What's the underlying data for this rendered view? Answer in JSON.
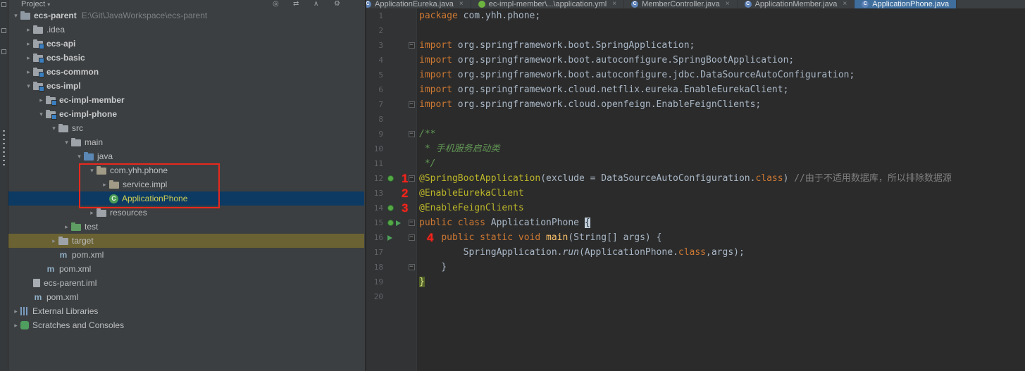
{
  "project_panel": {
    "header": {
      "title": "Project",
      "icons": [
        {
          "name": "locate-file-icon",
          "glyph": "◎"
        },
        {
          "name": "scroll-sync-icon",
          "glyph": "⇄"
        },
        {
          "name": "collapse-all-icon",
          "glyph": "∧"
        },
        {
          "name": "settings-icon",
          "glyph": "⚙"
        }
      ]
    },
    "tree": {
      "rows": [
        {
          "d": 0,
          "c": "o",
          "i": "project",
          "l": "ecs-parent",
          "x": "E:\\Git\\JavaWorkspace\\ecs-parent",
          "b": true
        },
        {
          "d": 1,
          "c": "c",
          "i": "folder",
          "l": ".idea"
        },
        {
          "d": 1,
          "c": "c",
          "i": "module",
          "l": "ecs-api",
          "b": true
        },
        {
          "d": 1,
          "c": "c",
          "i": "module",
          "l": "ecs-basic",
          "b": true
        },
        {
          "d": 1,
          "c": "c",
          "i": "module",
          "l": "ecs-common",
          "b": true
        },
        {
          "d": 1,
          "c": "o",
          "i": "module",
          "l": "ecs-impl",
          "b": true
        },
        {
          "d": 2,
          "c": "c",
          "i": "module",
          "l": "ec-impl-member",
          "b": true
        },
        {
          "d": 2,
          "c": "o",
          "i": "module",
          "l": "ec-impl-phone",
          "b": true
        },
        {
          "d": 3,
          "c": "o",
          "i": "folder",
          "l": "src"
        },
        {
          "d": 4,
          "c": "o",
          "i": "folder",
          "l": "main"
        },
        {
          "d": 5,
          "c": "o",
          "i": "java",
          "l": "java"
        },
        {
          "d": 6,
          "c": "o",
          "i": "package",
          "l": "com.yhh.phone"
        },
        {
          "d": 7,
          "c": "c",
          "i": "package",
          "l": "service.impl"
        },
        {
          "d": 7,
          "c": null,
          "i": "class",
          "l": "ApplicationPhone",
          "sel": true
        },
        {
          "d": 6,
          "c": "c",
          "i": "folder",
          "l": "resources"
        },
        {
          "d": 4,
          "c": "c",
          "i": "test",
          "l": "test"
        },
        {
          "d": 3,
          "c": "c",
          "i": "folder",
          "l": "target",
          "row": "olive"
        },
        {
          "d": 3,
          "c": null,
          "i": "maven",
          "l": "pom.xml"
        },
        {
          "d": 2,
          "c": null,
          "i": "maven",
          "l": "pom.xml"
        },
        {
          "d": 1,
          "c": null,
          "i": "iml",
          "l": "ecs-parent.iml"
        },
        {
          "d": 1,
          "c": null,
          "i": "maven",
          "l": "pom.xml"
        },
        {
          "d": 0,
          "c": "c",
          "i": "lib",
          "l": "External Libraries"
        },
        {
          "d": 0,
          "c": "c",
          "i": "scratch",
          "l": "Scratches and Consoles"
        }
      ]
    },
    "colors": {
      "selection": "#0d3a63",
      "excluded_row": "#6b6233",
      "annotation_red": "#e8281e"
    }
  },
  "editor": {
    "tabs": [
      {
        "l": "ApplicationEureka.java",
        "i": "class",
        "close": true
      },
      {
        "l": "ec-impl-member\\...\\application.yml",
        "i": "spring",
        "close": true
      },
      {
        "l": "MemberController.java",
        "i": "class",
        "close": true
      },
      {
        "l": "ApplicationMember.java",
        "i": "class",
        "close": true
      },
      {
        "l": "ApplicationPhone.java",
        "i": "class",
        "close": false,
        "active": true
      }
    ],
    "active_tab_color": "#3f6e9d",
    "lines": [
      {
        "n": 1,
        "s": [
          [
            "k",
            "package"
          ],
          [
            "p",
            " com.yhh.phone;"
          ]
        ]
      },
      {
        "n": 2,
        "s": []
      },
      {
        "n": 3,
        "f": "m",
        "s": [
          [
            "k",
            "import"
          ],
          [
            "p",
            " org.springframework.boot.SpringApplication;"
          ]
        ]
      },
      {
        "n": 4,
        "s": [
          [
            "k",
            "import"
          ],
          [
            "p",
            " org.springframework.boot.autoconfigure.SpringBootApplication;"
          ]
        ]
      },
      {
        "n": 5,
        "s": [
          [
            "k",
            "import"
          ],
          [
            "p",
            " org.springframework.boot.autoconfigure.jdbc.DataSourceAutoConfiguration;"
          ]
        ]
      },
      {
        "n": 6,
        "s": [
          [
            "k",
            "import"
          ],
          [
            "p",
            " org.springframework.cloud.netflix.eureka.EnableEurekaClient;"
          ]
        ]
      },
      {
        "n": 7,
        "f": "m",
        "s": [
          [
            "k",
            "import"
          ],
          [
            "p",
            " org.springframework.cloud.openfeign.EnableFeignClients;"
          ]
        ]
      },
      {
        "n": 8,
        "s": []
      },
      {
        "n": 9,
        "f": "m",
        "s": [
          [
            "d",
            "/**"
          ]
        ]
      },
      {
        "n": 10,
        "s": [
          [
            "d",
            " * 手机服务启动类"
          ]
        ]
      },
      {
        "n": 11,
        "s": [
          [
            "d",
            " */"
          ]
        ]
      },
      {
        "n": 12,
        "g": [
          "spring"
        ],
        "f": "m",
        "s": [
          [
            "a",
            "@SpringBootApplication"
          ],
          [
            "p",
            "(exclude = DataSourceAutoConfiguration."
          ],
          [
            "k",
            "class"
          ],
          [
            "p",
            ") "
          ],
          [
            "c",
            "//由于不适用数据库，所以排除数据源"
          ]
        ]
      },
      {
        "n": 13,
        "s": [
          [
            "a",
            "@EnableEurekaClient"
          ]
        ]
      },
      {
        "n": 14,
        "g": [
          "spring"
        ],
        "s": [
          [
            "a",
            "@EnableFeignClients"
          ]
        ]
      },
      {
        "n": 15,
        "g": [
          "spring",
          "run"
        ],
        "f": "m",
        "s": [
          [
            "k",
            "public class"
          ],
          [
            "p",
            " ApplicationPhone "
          ],
          [
            "b1",
            "{"
          ]
        ]
      },
      {
        "n": 16,
        "g": [
          "run"
        ],
        "f": "m",
        "s": [
          [
            "p",
            "    "
          ],
          [
            "k",
            "public static void"
          ],
          [
            "p",
            " "
          ],
          [
            "m",
            "main"
          ],
          [
            "p",
            "(String[] args) {"
          ]
        ]
      },
      {
        "n": 17,
        "s": [
          [
            "p",
            "        SpringApplication."
          ],
          [
            "i",
            "run"
          ],
          [
            "p",
            "(ApplicationPhone."
          ],
          [
            "k",
            "class"
          ],
          [
            "p",
            ",args);"
          ]
        ]
      },
      {
        "n": 18,
        "f": "m",
        "s": [
          [
            "p",
            "    }"
          ]
        ]
      },
      {
        "n": 19,
        "s": [
          [
            "b2",
            "}"
          ]
        ]
      },
      {
        "n": 20,
        "s": []
      }
    ],
    "annotations": [
      {
        "t": "1",
        "line": 12,
        "x": 50
      },
      {
        "t": "2",
        "line": 13,
        "x": 50
      },
      {
        "t": "3",
        "line": 14,
        "x": 50
      },
      {
        "t": "4",
        "line": 16,
        "x": 86
      }
    ],
    "syntax_colors": {
      "keyword": "#cc7832",
      "plain": "#a9b7c6",
      "annotation": "#bbb529",
      "comment": "#7f7f7f",
      "javadoc": "#629755",
      "method_decl": "#ffc66b",
      "background": "#2b2b2b",
      "gutter": "#313335",
      "line_number": "#606366",
      "annotation_number_red": "#f5231a"
    }
  },
  "icons": {
    "chevron_open": "▾",
    "chevron_closed": "▸",
    "close": "×"
  }
}
